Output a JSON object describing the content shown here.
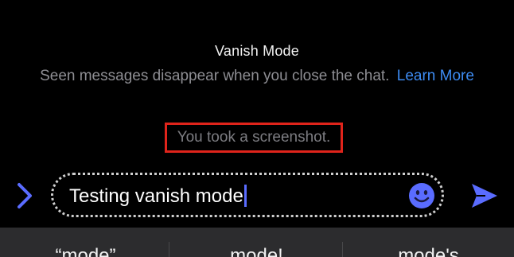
{
  "banner": {
    "title": "Vanish Mode",
    "subtitle": "Seen messages disappear when you close the chat.",
    "link": "Learn More"
  },
  "notice": {
    "text": "You took a screenshot."
  },
  "composer": {
    "value": "Testing vanish mode",
    "expand_icon": "chevron-right-icon",
    "emoji_icon": "smiley-icon",
    "send_icon": "send-icon"
  },
  "keyboard": {
    "suggestions": [
      "“mode”",
      "mode!",
      "mode's"
    ]
  },
  "colors": {
    "accent": "#5a6cff",
    "link": "#3d8bf2",
    "highlight_border": "#e0241b"
  }
}
